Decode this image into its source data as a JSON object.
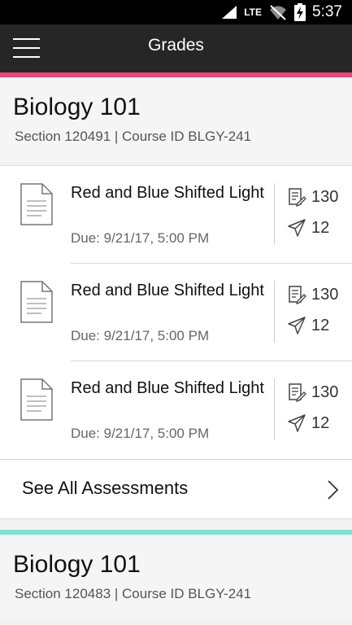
{
  "status_bar": {
    "network": "LTE",
    "time": "5:37"
  },
  "app_bar": {
    "title": "Grades",
    "menu_icon": "hamburger-menu-icon"
  },
  "courses": [
    {
      "accent_color": "#e8457a",
      "title": "Biology 101",
      "subtitle": "Section 120491 | Course ID BLGY-241",
      "assessments": [
        {
          "title": "Red and Blue Shifted Light",
          "due": "Due: 9/21/17, 5:00 PM",
          "graded_count": "130",
          "submitted_count": "12"
        },
        {
          "title": "Red and Blue Shifted Light",
          "due": "Due: 9/21/17, 5:00 PM",
          "graded_count": "130",
          "submitted_count": "12"
        },
        {
          "title": "Red and Blue Shifted Light",
          "due": "Due: 9/21/17, 5:00 PM",
          "graded_count": "130",
          "submitted_count": "12"
        }
      ],
      "see_all_label": "See All Assessments"
    },
    {
      "accent_color": "#7fe3cf",
      "title": "Biology 101",
      "subtitle": "Section 120483 | Course ID BLGY-241"
    }
  ],
  "icons": {
    "document": "document-icon",
    "graded": "graded-list-icon",
    "submitted": "paper-plane-icon",
    "chevron": "chevron-right-icon"
  }
}
